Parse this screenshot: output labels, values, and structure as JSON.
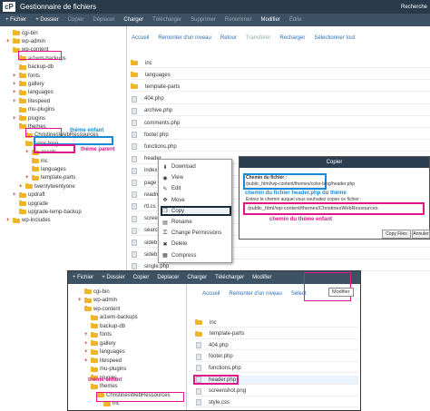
{
  "header": {
    "logo": "cP",
    "title": "Gestionnaire de fichiers",
    "search_label": "Recherche"
  },
  "toolbar": [
    "+ Fichier",
    "+ Dossier",
    "Copier",
    "Déplacer",
    "Charger",
    "Télécharger",
    "Supprimer",
    "Renommer",
    "Modifier",
    "Édite"
  ],
  "toolbar_disabled": [
    false,
    false,
    true,
    true,
    false,
    true,
    true,
    true,
    false,
    true
  ],
  "tree": [
    {
      "label": "cgi-bin",
      "indent": 1,
      "plus": false
    },
    {
      "label": "wp-admin",
      "indent": 1,
      "plus": true
    },
    {
      "label": "wp-content",
      "indent": 1,
      "plus": false,
      "open": true
    },
    {
      "label": "ai1wm-backups",
      "indent": 2,
      "plus": false
    },
    {
      "label": "backup-db",
      "indent": 2,
      "plus": false
    },
    {
      "label": "fonts",
      "indent": 2,
      "plus": true
    },
    {
      "label": "gallery",
      "indent": 2,
      "plus": true
    },
    {
      "label": "languages",
      "indent": 2,
      "plus": true
    },
    {
      "label": "litespeed",
      "indent": 2,
      "plus": true
    },
    {
      "label": "mu-plugins",
      "indent": 2,
      "plus": false
    },
    {
      "label": "plugins",
      "indent": 2,
      "plus": true
    },
    {
      "label": "themes",
      "indent": 2,
      "plus": false,
      "open": true
    },
    {
      "label": "ChristinesWebRessources",
      "indent": 3,
      "plus": false,
      "open": true
    },
    {
      "label": "color-blog",
      "indent": 3,
      "plus": false,
      "open": true
    },
    {
      "label": "assets",
      "indent": 4,
      "plus": true
    },
    {
      "label": "inc",
      "indent": 4,
      "plus": false
    },
    {
      "label": "languages",
      "indent": 4,
      "plus": false
    },
    {
      "label": "template-parts",
      "indent": 4,
      "plus": true
    },
    {
      "label": "twentytwentyone",
      "indent": 3,
      "plus": true
    },
    {
      "label": "updraft",
      "indent": 2,
      "plus": true
    },
    {
      "label": "upgrade",
      "indent": 2,
      "plus": false
    },
    {
      "label": "upgrade-temp-backup",
      "indent": 2,
      "plus": false
    },
    {
      "label": "wp-includes",
      "indent": 1,
      "plus": true
    }
  ],
  "nav": [
    "Accueil",
    "Remonter d'un niveau",
    "Retour",
    "Transférer",
    "Recharger",
    "Sélectionner tout"
  ],
  "nav_disabled": [
    false,
    false,
    false,
    true,
    false,
    false
  ],
  "files": [
    {
      "name": "inc",
      "type": "folder"
    },
    {
      "name": "languages",
      "type": "folder"
    },
    {
      "name": "template-parts",
      "type": "folder"
    },
    {
      "name": "404.php",
      "type": "file"
    },
    {
      "name": "archive.php",
      "type": "file"
    },
    {
      "name": "comments.php",
      "type": "file"
    },
    {
      "name": "footer.php",
      "type": "file"
    },
    {
      "name": "functions.php",
      "type": "file"
    },
    {
      "name": "header",
      "type": "file"
    },
    {
      "name": "index",
      "type": "file"
    },
    {
      "name": "page",
      "type": "file"
    },
    {
      "name": "readm",
      "type": "file"
    },
    {
      "name": "rtl.cs",
      "type": "file"
    },
    {
      "name": "scree",
      "type": "file"
    },
    {
      "name": "searc",
      "type": "file"
    },
    {
      "name": "sideb",
      "type": "file"
    },
    {
      "name": "sideb",
      "type": "file"
    },
    {
      "name": "single.php",
      "type": "file"
    }
  ],
  "context_menu": [
    {
      "icon": "download-icon",
      "glyph": "⬇",
      "label": "Download"
    },
    {
      "icon": "eye-icon",
      "glyph": "◉",
      "label": "View"
    },
    {
      "icon": "pencil-icon",
      "glyph": "✎",
      "label": "Edit"
    },
    {
      "icon": "move-icon",
      "glyph": "✥",
      "label": "Move"
    },
    {
      "icon": "copy-icon",
      "glyph": "❐",
      "label": "Copy"
    },
    {
      "icon": "rename-icon",
      "glyph": "▤",
      "label": "Rename"
    },
    {
      "icon": "key-icon",
      "glyph": "⚿",
      "label": "Change Permissions"
    },
    {
      "icon": "delete-icon",
      "glyph": "✖",
      "label": "Delete"
    },
    {
      "icon": "compress-icon",
      "glyph": "▦",
      "label": "Compress"
    }
  ],
  "dialog": {
    "title": "Copier",
    "path_label": "Chemin du fichier :",
    "path_value": "/public_html/wp-content/themes/color-blog/header.php",
    "dest_label": "Entrez le chemin auquel vous souhaitez copier ce fichier :",
    "dest_value": "/public_html/wp-content/themes/ChristinesWebRessources",
    "copy_button": "Copy Files",
    "cancel_button": "Annuler"
  },
  "annotations": {
    "theme_enfant": "thème enfant",
    "theme_parent": "thème parent",
    "chemin_fichier": "chemin du fichier header.php du thème",
    "chemin_enfant": "chemin du thème enfant",
    "theme_enfant_2": "thème enfant"
  },
  "shot2": {
    "toolbar": [
      "+ Fichier",
      "+ Dossier",
      "Copier",
      "Déplacer",
      "Charger",
      "Télécharger",
      "Modifier"
    ],
    "tooltip": "Modifier",
    "nav": [
      "Accueil",
      "Remonter d'un niveau",
      "Sélect"
    ],
    "tree": [
      {
        "label": "cgi-bin",
        "indent": 1,
        "plus": false
      },
      {
        "label": "wp-admin",
        "indent": 1,
        "plus": true
      },
      {
        "label": "wp-content",
        "indent": 1,
        "plus": false
      },
      {
        "label": "ai1wm-backups",
        "indent": 2,
        "plus": false
      },
      {
        "label": "backup-db",
        "indent": 2,
        "plus": false
      },
      {
        "label": "fonts",
        "indent": 2,
        "plus": true
      },
      {
        "label": "gallery",
        "indent": 2,
        "plus": true
      },
      {
        "label": "languages",
        "indent": 2,
        "plus": true
      },
      {
        "label": "litespeed",
        "indent": 2,
        "plus": true
      },
      {
        "label": "mu-plugins",
        "indent": 2,
        "plus": false
      },
      {
        "label": "plugins",
        "indent": 2,
        "plus": false
      },
      {
        "label": "themes",
        "indent": 2,
        "plus": false
      },
      {
        "label": "ChristinesWebRessources",
        "indent": 3,
        "plus": false
      },
      {
        "label": "inc",
        "indent": 4,
        "plus": false
      }
    ],
    "files": [
      "inc",
      "template-parts",
      "404.php",
      "footer.php",
      "functions.php",
      "header.php",
      "screenshot.png",
      "style.css"
    ]
  },
  "colors": {
    "accent_blue": "#1b8ad6",
    "accent_pink": "#e0168a",
    "header_bg": "#293a4a",
    "toolbar_bg": "#3e5266"
  }
}
